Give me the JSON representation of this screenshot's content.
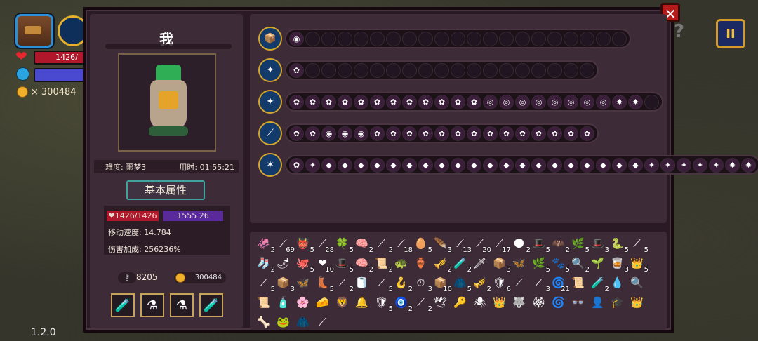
{
  "hud": {
    "hp_text": "1426/",
    "gold": "300484",
    "gold_prefix": "×",
    "version": "1.2.0",
    "pause_glyph": "II",
    "help_glyph": "?"
  },
  "panel": {
    "close_glyph": "✕",
    "player_name": "我",
    "difficulty": "难度: 噩梦3",
    "time_used": "用时: 01:55:21",
    "attr_button": "基本属性",
    "stats": {
      "hp": "1426/1426",
      "mp": "1555",
      "mp_suffix": "26",
      "speed": "移动速度: 14.784",
      "damage": "伤害加成: 256236%"
    },
    "keys": "8205",
    "gold": "300484",
    "potions": [
      "🧪",
      "⚗",
      "⚗",
      "🧪"
    ]
  },
  "weapons": [
    {
      "icon": "📦",
      "slots": [
        "◉",
        "",
        "",
        "",
        "",
        "",
        "",
        "",
        "",
        "",
        "",
        "",
        "",
        "",
        "",
        "",
        "",
        "",
        "",
        "",
        ""
      ]
    },
    {
      "icon": "✦",
      "slots": [
        "✿",
        "",
        "",
        "",
        "",
        "",
        "",
        "",
        "",
        "",
        "",
        "",
        "",
        "",
        "",
        "",
        "",
        "",
        ""
      ]
    },
    {
      "icon": "✦",
      "slots": [
        "✿",
        "✿",
        "✿",
        "✿",
        "✿",
        "✿",
        "✿",
        "✿",
        "✿",
        "✿",
        "✿",
        "✿",
        "◎",
        "◎",
        "◎",
        "◎",
        "◎",
        "◎",
        "◎",
        "◎",
        "✸",
        "✸",
        ""
      ]
    },
    {
      "icon": "⟋",
      "slots": [
        "✿",
        "✿",
        "◉",
        "◉",
        "◉",
        "✿",
        "✿",
        "✿",
        "✿",
        "✿",
        "✿",
        "✿",
        "✿",
        "✿",
        "✿",
        "✿",
        "✿",
        "✿",
        "✿"
      ]
    },
    {
      "icon": "✶",
      "slots": [
        "✿",
        "✦",
        "◆",
        "◆",
        "◆",
        "◆",
        "◆",
        "◆",
        "◆",
        "◆",
        "◆",
        "◆",
        "◆",
        "◆",
        "◆",
        "◆",
        "◆",
        "◆",
        "◆",
        "◆",
        "◆",
        "◆",
        "✦",
        "✦",
        "✦",
        "✦",
        "✦",
        "✸",
        "✸"
      ]
    }
  ],
  "inventory": [
    {
      "g": "🦑",
      "c": "2"
    },
    {
      "g": "⟋",
      "c": "69"
    },
    {
      "g": "👹",
      "c": "5"
    },
    {
      "g": "⟋",
      "c": "28"
    },
    {
      "g": "🍀",
      "c": "5"
    },
    {
      "g": "🧠",
      "c": "2"
    },
    {
      "g": "⟋",
      "c": "2"
    },
    {
      "g": "⟋",
      "c": "18"
    },
    {
      "g": "🥚",
      "c": "5"
    },
    {
      "g": "🪶",
      "c": "3"
    },
    {
      "g": "⟋",
      "c": "13"
    },
    {
      "g": "⟋",
      "c": "20"
    },
    {
      "g": "⟋",
      "c": "17"
    },
    {
      "g": "🌑",
      "c": "2"
    },
    {
      "g": "🎩",
      "c": "5"
    },
    {
      "g": "🦇",
      "c": "2"
    },
    {
      "g": "🌿",
      "c": "5"
    },
    {
      "g": "🎩",
      "c": "3"
    },
    {
      "g": "🐍",
      "c": "5"
    },
    {
      "g": "⟋",
      "c": "5"
    },
    {
      "g": "🧦",
      "c": "2"
    },
    {
      "g": "🌶",
      "c": ""
    },
    {
      "g": "🐙",
      "c": "5"
    },
    {
      "g": "❤",
      "c": "10"
    },
    {
      "g": "🎩",
      "c": "5"
    },
    {
      "g": "🧠",
      "c": "2"
    },
    {
      "g": "📜",
      "c": "2"
    },
    {
      "g": "🐢",
      "c": ""
    },
    {
      "g": "🏺",
      "c": ""
    },
    {
      "g": "🎺",
      "c": "2"
    },
    {
      "g": "🧪",
      "c": "2"
    },
    {
      "g": "🗡",
      "c": ""
    },
    {
      "g": "📦",
      "c": "3"
    },
    {
      "g": "🦋",
      "c": ""
    },
    {
      "g": "🌿",
      "c": "5"
    },
    {
      "g": "🐾",
      "c": "5"
    },
    {
      "g": "🔍",
      "c": "2"
    },
    {
      "g": "🌱",
      "c": ""
    },
    {
      "g": "🥃",
      "c": "3"
    },
    {
      "g": "👑",
      "c": "5"
    },
    {
      "g": "⟋",
      "c": "5"
    },
    {
      "g": "📦",
      "c": "3"
    },
    {
      "g": "🦋",
      "c": ""
    },
    {
      "g": "👢",
      "c": "5"
    },
    {
      "g": "⟋",
      "c": "2"
    },
    {
      "g": "🧻",
      "c": ""
    },
    {
      "g": "⟋",
      "c": "5"
    },
    {
      "g": "🪝",
      "c": "2"
    },
    {
      "g": "⏱",
      "c": "3"
    },
    {
      "g": "📦",
      "c": "10"
    },
    {
      "g": "🧥",
      "c": "5"
    },
    {
      "g": "🎺",
      "c": "2"
    },
    {
      "g": "🛡",
      "c": "6"
    },
    {
      "g": "⟋",
      "c": ""
    },
    {
      "g": "⟋",
      "c": "3"
    },
    {
      "g": "🌀",
      "c": "21"
    },
    {
      "g": "📜",
      "c": ""
    },
    {
      "g": "🧪",
      "c": "2"
    },
    {
      "g": "💧",
      "c": ""
    },
    {
      "g": "🔍",
      "c": ""
    },
    {
      "g": "📜",
      "c": ""
    },
    {
      "g": "🧴",
      "c": ""
    },
    {
      "g": "🌸",
      "c": ""
    },
    {
      "g": "🧀",
      "c": ""
    },
    {
      "g": "🦁",
      "c": ""
    },
    {
      "g": "🔔",
      "c": ""
    },
    {
      "g": "🛡",
      "c": "5"
    },
    {
      "g": "🧿",
      "c": "2"
    },
    {
      "g": "⟋",
      "c": "2"
    },
    {
      "g": "🕊",
      "c": ""
    },
    {
      "g": "🔑",
      "c": ""
    },
    {
      "g": "🕷",
      "c": ""
    },
    {
      "g": "👑",
      "c": ""
    },
    {
      "g": "🐺",
      "c": ""
    },
    {
      "g": "🏵",
      "c": ""
    },
    {
      "g": "🌀",
      "c": ""
    },
    {
      "g": "👓",
      "c": ""
    },
    {
      "g": "👤",
      "c": ""
    },
    {
      "g": "🎓",
      "c": ""
    },
    {
      "g": "👑",
      "c": ""
    },
    {
      "g": "🦴",
      "c": ""
    },
    {
      "g": "🐸",
      "c": ""
    },
    {
      "g": "🧥",
      "c": ""
    },
    {
      "g": "⟋",
      "c": ""
    }
  ]
}
